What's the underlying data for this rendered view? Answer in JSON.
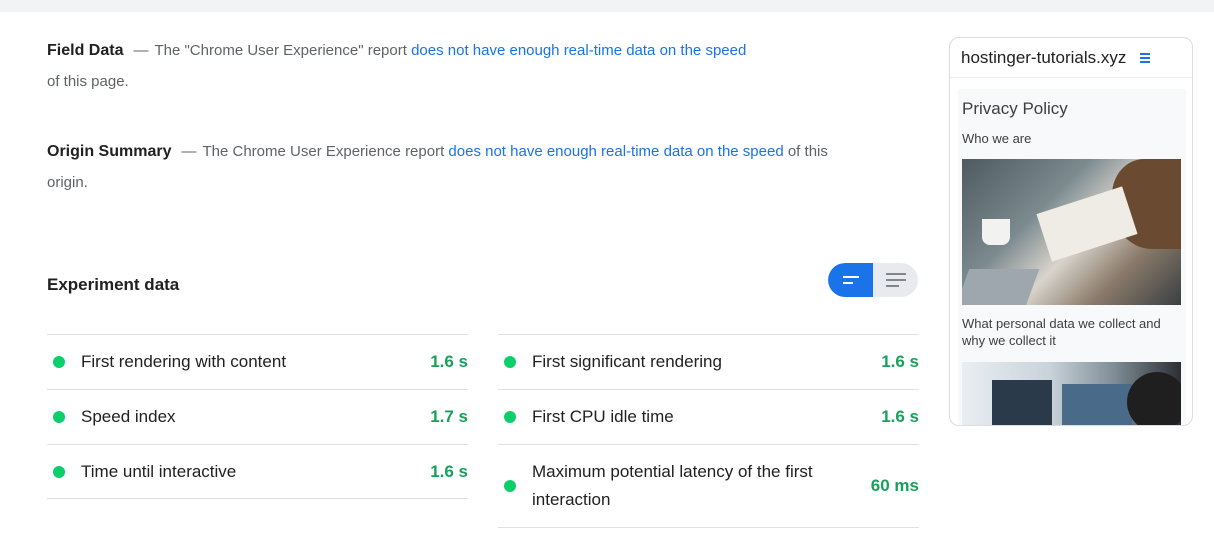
{
  "field_data": {
    "heading": "Field Data",
    "dash": "—",
    "text_before": "The \"Chrome User Experience\" report",
    "link": "does not have enough real-time data on the speed",
    "text_after": "of this page."
  },
  "origin_summary": {
    "heading": "Origin Summary",
    "dash": "—",
    "text_before": "The Chrome User Experience report",
    "link": "does not have enough real-time data on the speed",
    "text_after": "of this origin."
  },
  "experiment": {
    "title": "Experiment data",
    "toggle_icons": [
      "compact-view-icon",
      "list-view-icon"
    ],
    "left_metrics": [
      {
        "label": "First rendering with content",
        "value": "1.6 s"
      },
      {
        "label": "Speed index",
        "value": "1.7 s"
      },
      {
        "label": "Time until interactive",
        "value": "1.6 s"
      }
    ],
    "right_metrics": [
      {
        "label": "First significant rendering",
        "value": "1.6 s"
      },
      {
        "label": "First CPU idle time",
        "value": "1.6 s"
      },
      {
        "label": "Maximum potential latency of the first interaction",
        "value": "60 ms"
      }
    ]
  },
  "preview": {
    "site": "hostinger-tutorials.xyz",
    "page_title": "Privacy Policy",
    "subtitle": "Who we are",
    "paragraph": "What personal data we collect and why we collect it"
  },
  "colors": {
    "accent": "#1a73e8",
    "pass": "#0cce6b",
    "pass_text": "#18a15c"
  }
}
